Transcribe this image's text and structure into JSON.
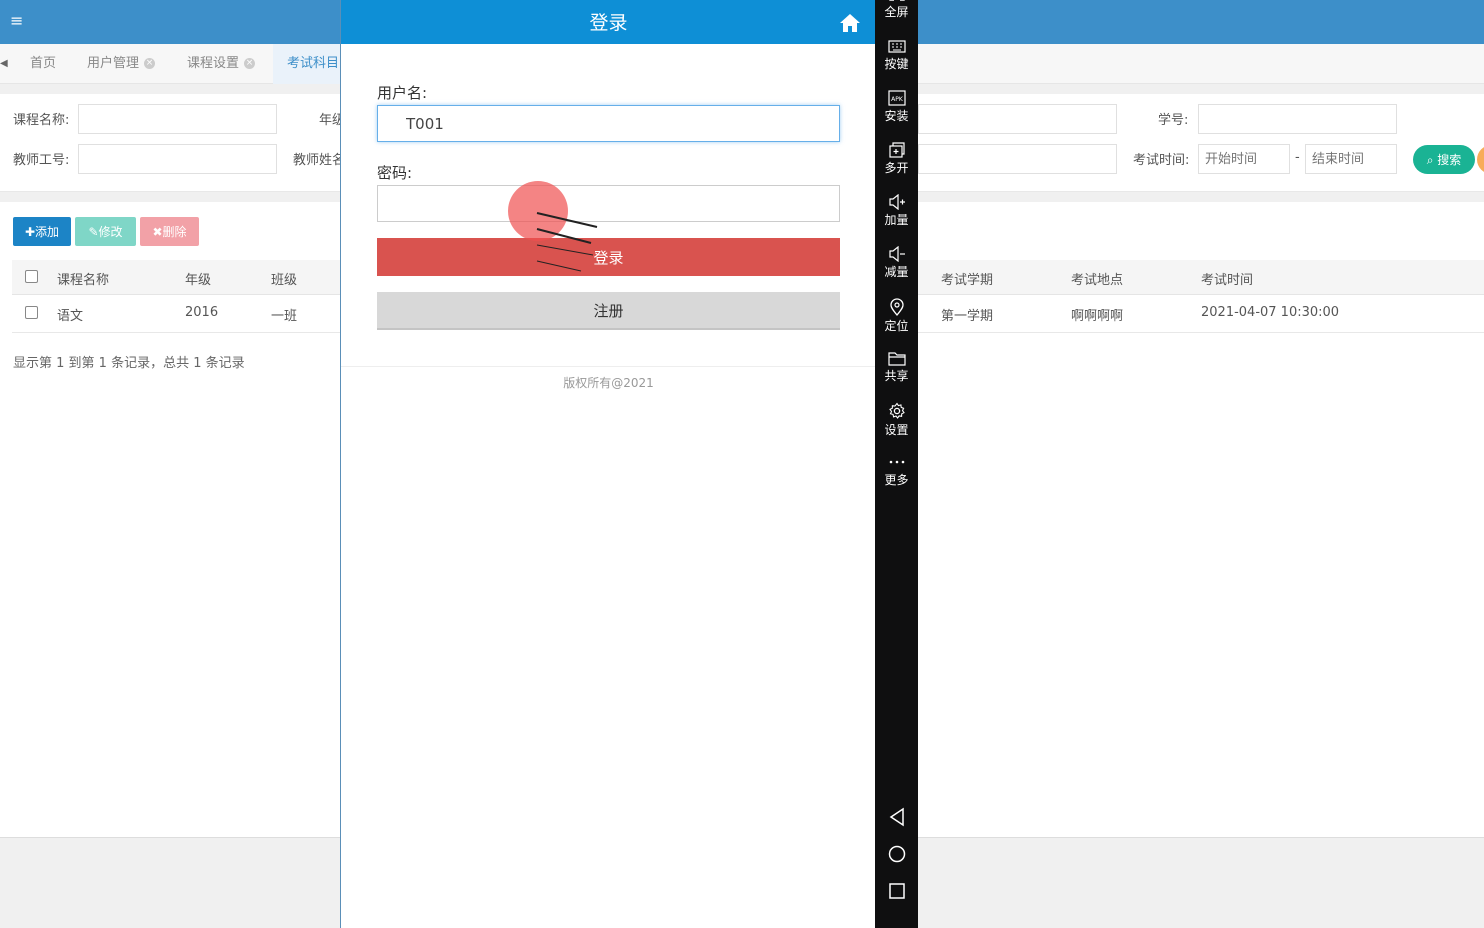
{
  "app": {
    "tabs": [
      {
        "label": "首页",
        "closable": false
      },
      {
        "label": "用户管理",
        "closable": true
      },
      {
        "label": "课程设置",
        "closable": true
      },
      {
        "label": "考试科目",
        "closable": false,
        "active": true
      }
    ],
    "search": {
      "course_name_label": "课程名称:",
      "grade_label": "年级",
      "student_id_label": "学号:",
      "teacher_id_label": "教师工号:",
      "teacher_name_label": "教师姓名",
      "exam_time_label": "考试时间:",
      "start_placeholder": "开始时间",
      "range_sep": "-",
      "end_placeholder": "结束时间",
      "search_button": "搜索"
    },
    "toolbar": {
      "add": "添加",
      "edit": "修改",
      "delete": "删除"
    },
    "table": {
      "columns": [
        "课程名称",
        "年级",
        "班级",
        "考试学期",
        "考试地点",
        "考试时间"
      ],
      "rows": [
        {
          "course": "语文",
          "grade": "2016",
          "class": "一班",
          "term": "第一学期",
          "location": "啊啊啊啊",
          "time": "2021-04-07 10:30:00"
        }
      ],
      "pager": "显示第 1 到第 1 条记录，总共 1 条记录"
    }
  },
  "login": {
    "title": "登录",
    "username_label": "用户名:",
    "username_value": "T001",
    "password_label": "密码:",
    "password_value": "",
    "login_button": "登录",
    "register_button": "注册",
    "copyright": "版权所有@2021"
  },
  "emulator": {
    "items": [
      {
        "label": "全屏",
        "icon": "fullscreen-icon"
      },
      {
        "label": "按键",
        "icon": "keyboard-icon"
      },
      {
        "label": "安装",
        "icon": "apk-icon"
      },
      {
        "label": "多开",
        "icon": "multi-instance-icon"
      },
      {
        "label": "加量",
        "icon": "volume-up-icon"
      },
      {
        "label": "减量",
        "icon": "volume-down-icon"
      },
      {
        "label": "定位",
        "icon": "location-icon"
      },
      {
        "label": "共享",
        "icon": "folder-icon"
      },
      {
        "label": "设置",
        "icon": "gear-icon"
      },
      {
        "label": "更多",
        "icon": "more-icon"
      }
    ],
    "apk_glyph": "APK"
  },
  "colors": {
    "topbar": "#3d8fc9",
    "login_header": "#0e8fd6",
    "login_button": "#d9534f",
    "search_button": "#1ab394",
    "add_button": "#1c84c6",
    "emulator_bar": "#0f0f10"
  }
}
